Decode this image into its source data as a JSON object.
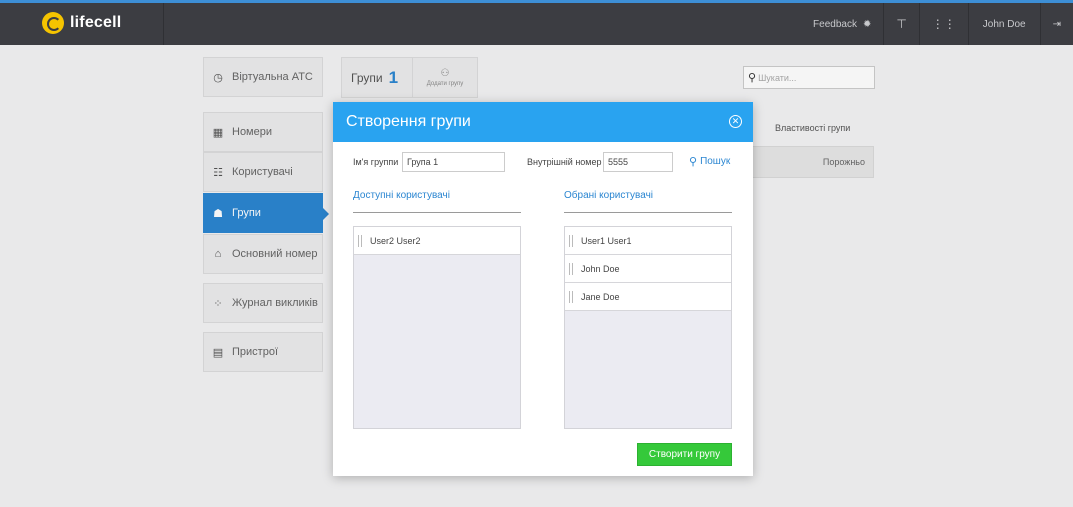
{
  "topbar": {
    "logo": "lifecell",
    "feedback": "Feedback",
    "user": "John Doe"
  },
  "sidebar": {
    "items": [
      {
        "label": "Віртуальна АТС",
        "icon": "dial-icon"
      },
      {
        "label": "Номери",
        "icon": "grid-icon"
      },
      {
        "label": "Користувачі",
        "icon": "users-list-icon"
      },
      {
        "label": "Групи",
        "icon": "group-icon",
        "active": true
      },
      {
        "label": "Основний номер",
        "icon": "home-icon"
      },
      {
        "label": "Журнал викликів",
        "icon": "network-icon"
      },
      {
        "label": "Пристрої",
        "icon": "device-icon"
      }
    ]
  },
  "background": {
    "groups_label": "Групи",
    "groups_count": "1",
    "add_group": "Додати групу",
    "search_placeholder": "Шукати...",
    "props_label": "Властивості групи",
    "empty_label": "Порожньо"
  },
  "modal": {
    "title": "Створення групи",
    "name_label": "Ім'я группи",
    "name_value": "Група 1",
    "ext_label": "Внутрішній номер",
    "ext_value": "5555",
    "search_label": "Пошук",
    "available_title": "Доступні користувачі",
    "selected_title": "Обрані користувачі",
    "available": [
      "User2 User2"
    ],
    "selected": [
      "User1 User1",
      "John Doe",
      "Jane Doe"
    ],
    "create_label": "Створити групу"
  },
  "colors": {
    "accent": "#2b86d1",
    "modal_header": "#29a3f0",
    "create_button": "#35c93a",
    "topbar": "#3c3d42"
  }
}
